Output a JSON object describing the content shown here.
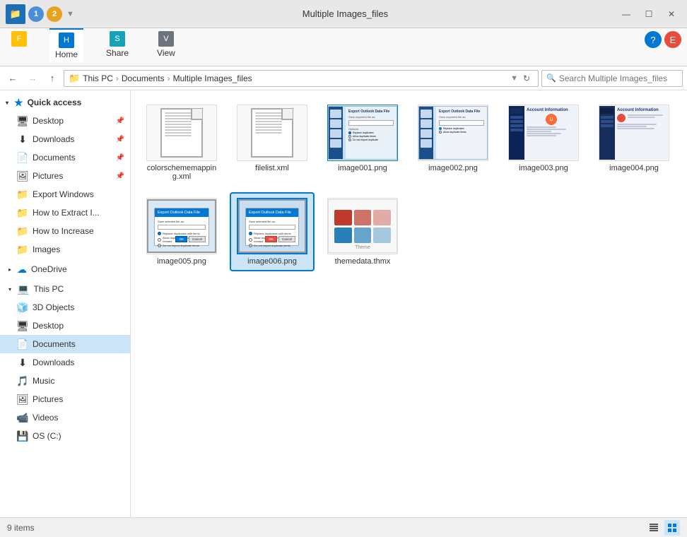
{
  "window": {
    "title": "Multiple Images_files",
    "tabs": [
      "1",
      "2"
    ],
    "ribbon_tabs": [
      {
        "label": "Home",
        "key": "H"
      },
      {
        "label": "Share",
        "key": "S"
      },
      {
        "label": "View",
        "key": "V"
      }
    ]
  },
  "toolbar": {
    "back_disabled": false,
    "forward_disabled": true,
    "breadcrumb": [
      "This PC",
      "Documents",
      "Multiple Images_files"
    ],
    "search_placeholder": "Search Multiple Images_files"
  },
  "sidebar": {
    "quick_access_label": "Quick access",
    "items_qa": [
      {
        "label": "Desktop",
        "pinned": true
      },
      {
        "label": "Downloads",
        "pinned": true
      },
      {
        "label": "Documents",
        "pinned": true
      },
      {
        "label": "Pictures",
        "pinned": true
      },
      {
        "label": "Export Windows",
        "pinned": false
      },
      {
        "label": "How to Extract I...",
        "pinned": false
      },
      {
        "label": "How to Increase",
        "pinned": false
      },
      {
        "label": "Images",
        "pinned": false
      }
    ],
    "onedrive_label": "OneDrive",
    "thispc_label": "This PC",
    "items_pc": [
      {
        "label": "3D Objects"
      },
      {
        "label": "Desktop"
      },
      {
        "label": "Documents",
        "active": true
      },
      {
        "label": "Downloads"
      },
      {
        "label": "Music"
      },
      {
        "label": "Pictures"
      },
      {
        "label": "Videos"
      },
      {
        "label": "OS (C:)"
      }
    ]
  },
  "files": [
    {
      "name": "colorschememap ping.xml",
      "type": "text",
      "display_name": "colorschememapping.xml"
    },
    {
      "name": "filelist.xml",
      "type": "text",
      "display_name": "filelist.xml"
    },
    {
      "name": "image001.png",
      "type": "ppt-screen",
      "display_name": "image001.png"
    },
    {
      "name": "image002.png",
      "type": "ppt-screen2",
      "display_name": "image002.png"
    },
    {
      "name": "image003.png",
      "type": "account",
      "display_name": "image003.png"
    },
    {
      "name": "image004.png",
      "type": "account2",
      "display_name": "image004.png"
    },
    {
      "name": "image005.png",
      "type": "dialog1",
      "display_name": "image005.png"
    },
    {
      "name": "image006.png",
      "type": "dialog2",
      "display_name": "image006.png",
      "selected": true
    },
    {
      "name": "themedata.thmx",
      "type": "thmx",
      "display_name": "themedata.thmx"
    }
  ],
  "status": {
    "item_count": "9 items",
    "selected_info": ""
  }
}
